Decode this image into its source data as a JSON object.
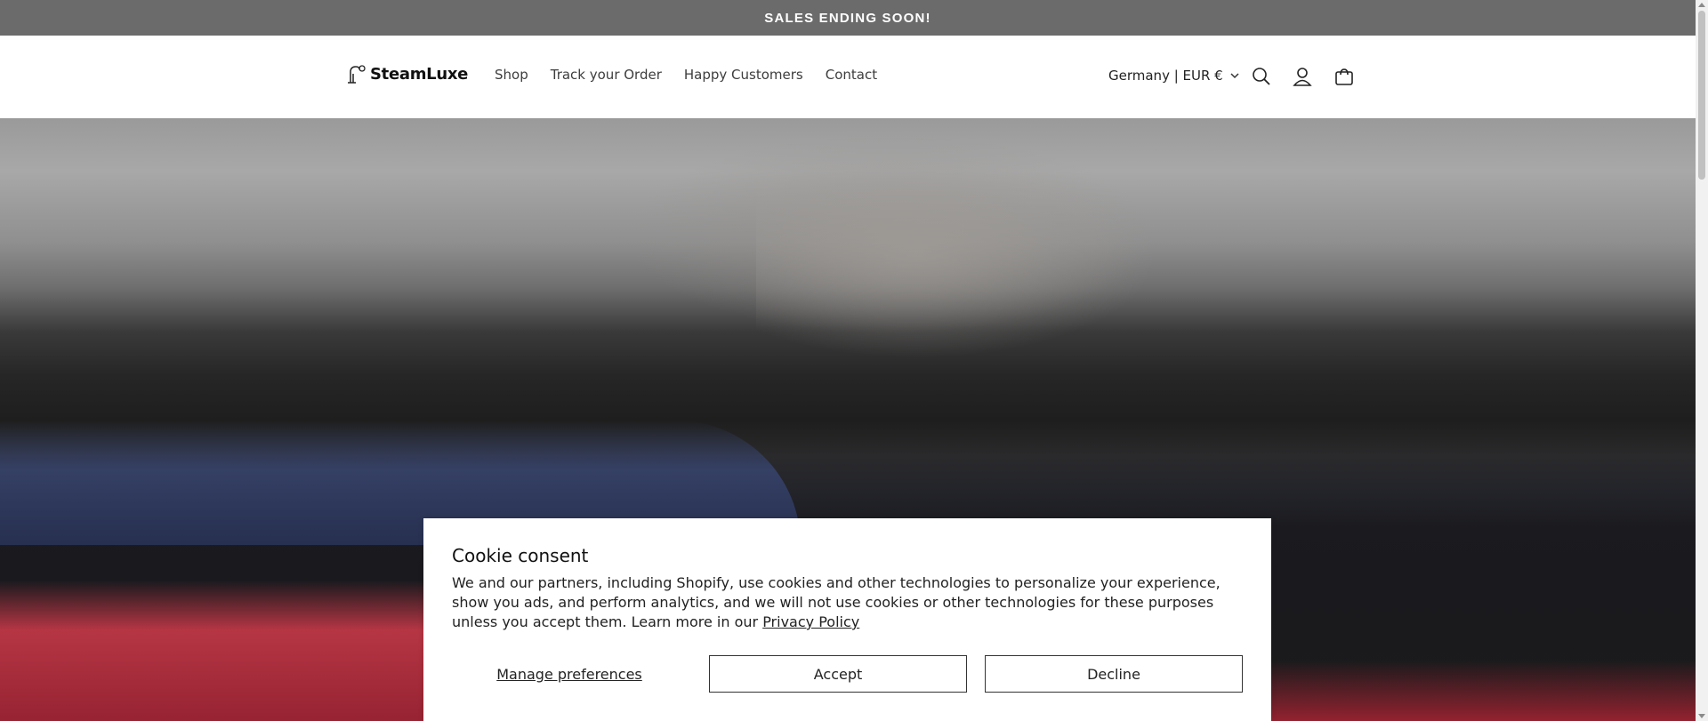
{
  "announcement": {
    "text": "SALES ENDING SOON!"
  },
  "header": {
    "logo_text": "SteamLuxe",
    "nav": [
      "Shop",
      "Track your Order",
      "Happy Customers",
      "Contact"
    ],
    "locale": "Germany | EUR €",
    "icons": [
      "search-icon",
      "account-icon",
      "cart-icon"
    ]
  },
  "cookie": {
    "title": "Cookie consent",
    "body": "We and our partners, including Shopify, use cookies and other technologies to personalize your experience, show you ads, and perform analytics, and we will not use cookies or other technologies for these purposes unless you accept them. Learn more in our ",
    "privacy_link": "Privacy Policy",
    "manage_label": "Manage preferences",
    "accept_label": "Accept",
    "decline_label": "Decline"
  },
  "colors": {
    "announcement_bg": "#6b6b6b",
    "text": "#121212"
  }
}
